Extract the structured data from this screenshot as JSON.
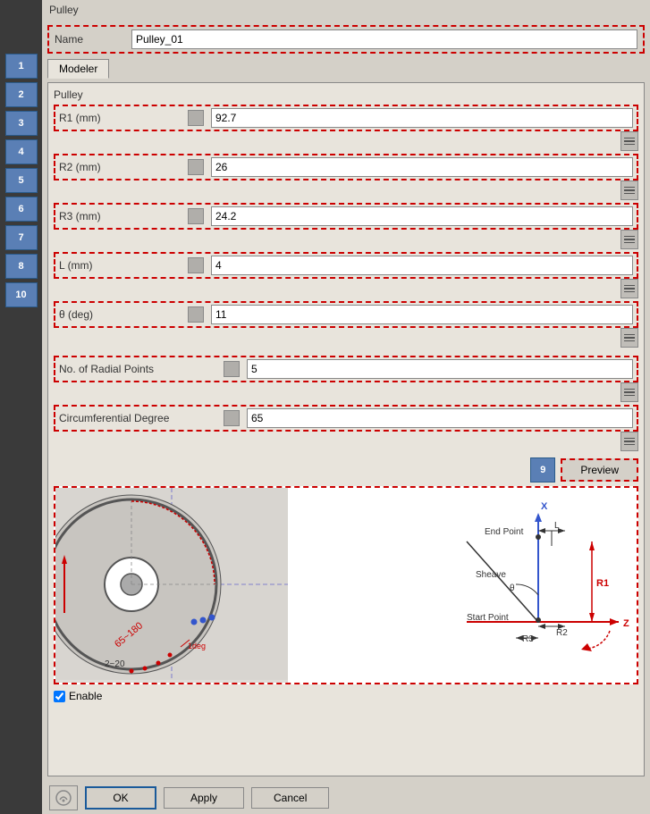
{
  "title": "Pulley",
  "sidebar": {
    "buttons": [
      {
        "label": "1",
        "id": "btn-1"
      },
      {
        "label": "2",
        "id": "btn-2"
      },
      {
        "label": "3",
        "id": "btn-3"
      },
      {
        "label": "4",
        "id": "btn-4"
      },
      {
        "label": "5",
        "id": "btn-5"
      },
      {
        "label": "6",
        "id": "btn-6"
      },
      {
        "label": "7",
        "id": "btn-7"
      },
      {
        "label": "8",
        "id": "btn-8"
      },
      {
        "label": "10",
        "id": "btn-10"
      }
    ]
  },
  "name_label": "Name",
  "name_value": "Pulley_01",
  "tab_label": "Modeler",
  "panel_title": "Pulley",
  "fields": [
    {
      "label": "R1 (mm)",
      "value": "92.7"
    },
    {
      "label": "R2 (mm)",
      "value": "26"
    },
    {
      "label": "R3 (mm)",
      "value": "24.2"
    },
    {
      "label": "L (mm)",
      "value": "4"
    },
    {
      "label": "θ (deg)",
      "value": "11"
    }
  ],
  "extra_fields": [
    {
      "label": "No. of Radial Points",
      "value": "5"
    },
    {
      "label": "Circumferential Degree",
      "value": "65"
    }
  ],
  "preview_badge": "9",
  "preview_btn_label": "Preview",
  "diagram": {
    "left_annotations": [
      "65~180",
      "2~20",
      "1deg"
    ],
    "right_annotations": [
      "End Point",
      "L",
      "Sheave",
      "θ",
      "R1",
      "Start Point",
      "R3",
      "R2",
      "X",
      "Z"
    ]
  },
  "enable_label": "Enable",
  "buttons": {
    "ok_label": "OK",
    "apply_label": "Apply",
    "cancel_label": "Cancel"
  }
}
